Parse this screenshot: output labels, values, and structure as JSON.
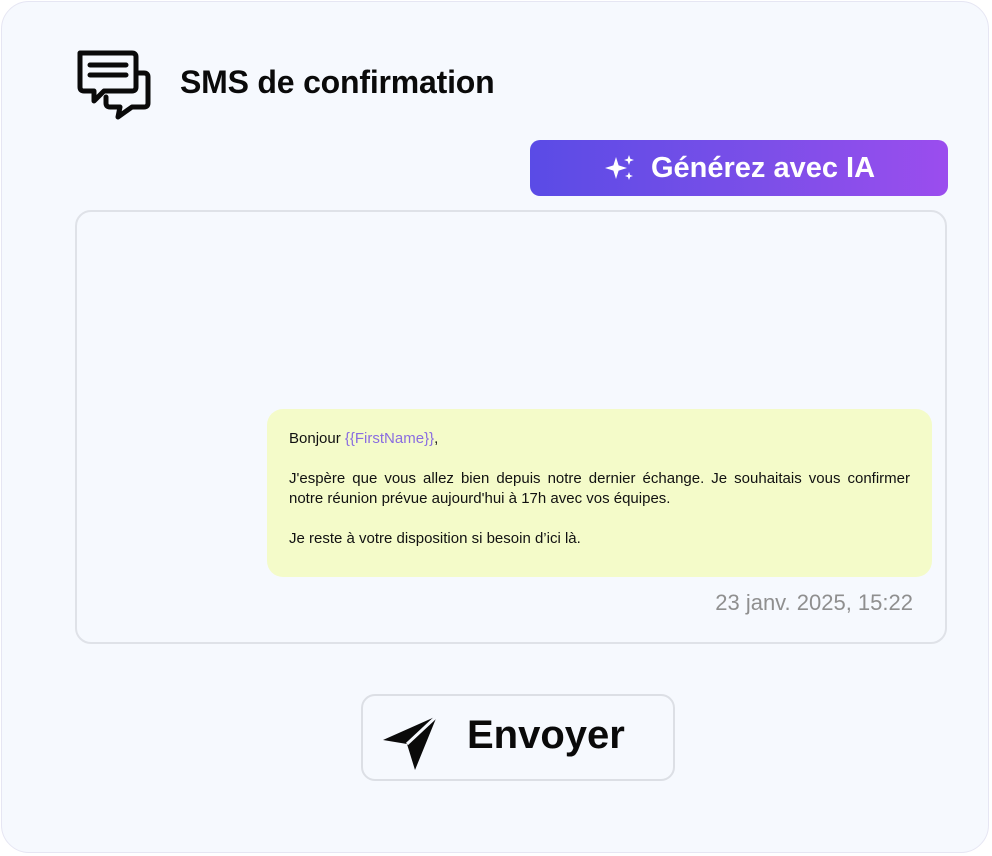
{
  "header": {
    "title": "SMS de confirmation",
    "icon": "chat-bubbles-icon"
  },
  "ai_button": {
    "label": "Générez avec IA",
    "icon": "sparkle-icon",
    "gradient_start": "#5a4be6",
    "gradient_end": "#9b4dee"
  },
  "message": {
    "greeting_prefix": "Bonjour ",
    "variable_token": "{{FirstName}}",
    "greeting_suffix": ",",
    "paragraph_1": "J'espère que vous allez bien depuis notre dernier échange. Je souhaitais vous confirmer notre réunion prévue aujourd'hui à 17h avec vos équipes.",
    "paragraph_2": "Je reste à votre disposition si besoin d’ici là.",
    "timestamp": "23 janv. 2025, 15:22",
    "bubble_color": "#f4fbc9",
    "token_color": "#8a6de0"
  },
  "send_button": {
    "label": "Envoyer",
    "icon": "paper-plane-icon"
  }
}
